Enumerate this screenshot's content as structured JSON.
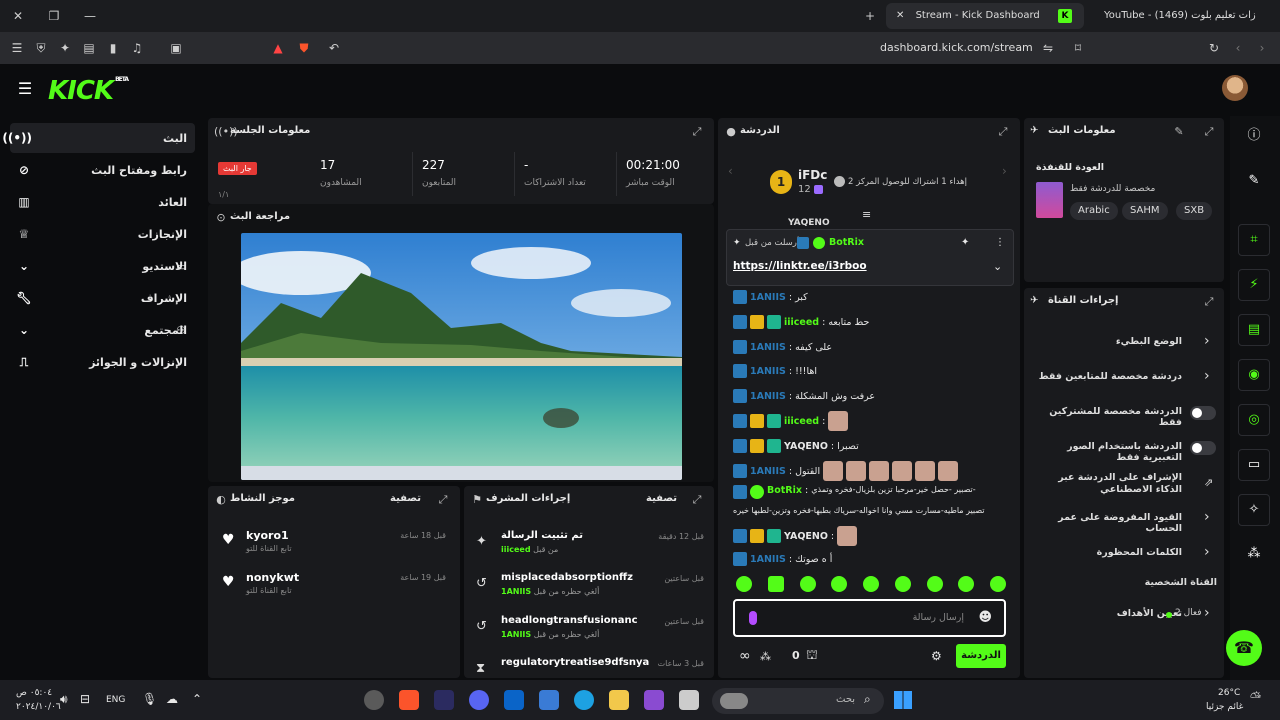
{
  "browser": {
    "tabs": [
      {
        "label": "Stream - Kick Dashboard",
        "active": true
      },
      {
        "label": "YouTube - (1469) زات تعليم بلوت",
        "active": false
      }
    ],
    "url": "dashboard.kick.com/stream"
  },
  "brand": {
    "logo": "KICK",
    "beta": "BETA",
    "accent": "#53fc18"
  },
  "nav": {
    "items": [
      {
        "label": "البث",
        "icon": "broadcast-icon",
        "active": true
      },
      {
        "label": "رابط ومفتاح البث",
        "icon": "link-icon"
      },
      {
        "label": "العائد",
        "icon": "chart-icon"
      },
      {
        "label": "الإنجازات",
        "icon": "trophy-icon"
      },
      {
        "label": "الاستديو",
        "icon": "studio-icon",
        "expandable": true
      },
      {
        "label": "الإشراف",
        "icon": "wrench-icon"
      },
      {
        "label": "المجتمع",
        "icon": "community-icon",
        "expandable": true
      },
      {
        "label": "الإنزالات و الجوائز",
        "icon": "drops-icon"
      }
    ]
  },
  "session": {
    "title": "معلومات الجلسة",
    "live_badge": "جار البث",
    "live_sub": "١/١",
    "stats": [
      {
        "value": "17",
        "label": "المشاهدون"
      },
      {
        "value": "227",
        "label": "المتابعون"
      },
      {
        "value": "-",
        "label": "تعداد الاشتراكات"
      },
      {
        "value": "00:21:00",
        "label": "الوقت مباشر"
      }
    ]
  },
  "preview": {
    "title": "مراجعة البث"
  },
  "activity": {
    "title": "موجز النشاط",
    "filter": "تصفية",
    "items": [
      {
        "name": "kyoro1",
        "sub": "تابع القناة للتو",
        "time": "قبل 18 ساعة"
      },
      {
        "name": "nonykwt",
        "sub": "تابع القناة للتو",
        "time": "قبل 19 ساعة"
      }
    ]
  },
  "mod_actions": {
    "title": "إجراءات المشرف",
    "filter": "تصفية",
    "items": [
      {
        "name": "تم تثبيت الرسالة",
        "sub_pre": "من قبل",
        "by": "iiiceed",
        "time": "قبل 12 دقيقة",
        "icon": "pin-icon"
      },
      {
        "name": "misplacedabsorptionffz",
        "sub_pre": "ألغي حظره من قبل",
        "by": "1ANIIS",
        "time": "قبل ساعتين",
        "icon": "undo-icon"
      },
      {
        "name": "headlongtransfusionanc",
        "sub_pre": "ألغي حظره من قبل",
        "by": "1ANIIS",
        "time": "قبل ساعتين",
        "icon": "undo-icon"
      },
      {
        "name": "regulatorytreatise9dfsnya",
        "sub_pre": "",
        "by": "",
        "time": "قبل 3 ساعات",
        "icon": "hourglass-icon"
      }
    ]
  },
  "chat": {
    "title": "الدردشة",
    "top_gifter": {
      "name": "iFDc",
      "rank": "1",
      "count": "12",
      "text": "إهداء 1 اشتراك للوصول المركز 2"
    },
    "pinned": {
      "label": "أرسلت من قبل",
      "user": "BotRix",
      "link": "https://linktr.ee/i3rboo"
    },
    "cut_top": "YAQENO",
    "messages": [
      {
        "user": "1ANIIS",
        "color": "#2a7ab8",
        "text": "كبر",
        "badges": [
          "mod"
        ]
      },
      {
        "user": "iiiceed",
        "color": "#53fc18",
        "text": "حط متابعه",
        "badges": [
          "mod",
          "crown",
          "sub"
        ]
      },
      {
        "user": "1ANIIS",
        "color": "#2a7ab8",
        "text": "على كيفه",
        "badges": [
          "mod"
        ]
      },
      {
        "user": "1ANIIS",
        "color": "#2a7ab8",
        "text": "!!!اها",
        "badges": [
          "mod"
        ]
      },
      {
        "user": "1ANIIS",
        "color": "#2a7ab8",
        "text": "عرفت وش المشكلة",
        "badges": [
          "mod"
        ]
      },
      {
        "user": "iiiceed",
        "color": "#53fc18",
        "text": "",
        "badges": [
          "mod",
          "crown",
          "sub"
        ],
        "emotes": 1
      },
      {
        "user": "YAQENO",
        "color": "#e8e8e8",
        "text": "تصبرا",
        "badges": [
          "mod",
          "crown",
          "sub"
        ]
      },
      {
        "user": "1ANIIS",
        "color": "#2a7ab8",
        "text": "القتول",
        "badges": [
          "mod"
        ],
        "emotes": 6
      },
      {
        "user": "BotRix",
        "color": "#53fc18",
        "text": "تصبير -حصل خير-مرحبا تزين بلزيال-فخره وتمذي-",
        "text2": "تصبير ماطيه-مسارت مسي وانا اخواله-سرياك بطبها-فخره وتزين-لطبها خيره",
        "badges": [
          "mod",
          "verified"
        ]
      },
      {
        "user": "YAQENO",
        "color": "#e8e8e8",
        "text": "",
        "badges": [
          "mod",
          "crown",
          "sub"
        ],
        "emotes": 1
      },
      {
        "user": "1ANIIS",
        "color": "#2a7ab8",
        "text": "أ ه صوتك",
        "badges": [
          "mod"
        ]
      }
    ],
    "input_placeholder": "إرسال رسالة",
    "send_label": "الدردشة",
    "infinite": "∞",
    "count": "0"
  },
  "stream_info": {
    "title": "معلومات البث",
    "stream_title": "العودة للقنفذة",
    "category": "مخصصة للدردشة فقط",
    "tags": [
      "Arabic",
      "SAHM",
      "SXB"
    ]
  },
  "channel_actions": {
    "title": "إجراءات القناة",
    "rows": [
      {
        "label": "الوضع البطيء",
        "kind": "chevron"
      },
      {
        "label": "دردشة مخصصة للمتابعين فقط",
        "kind": "chevron"
      },
      {
        "label": "الدردشة مخصصة للمشتركين فقط",
        "kind": "toggle"
      },
      {
        "label": "الدردشة باستخدام الصور التعبيرية فقط",
        "kind": "toggle"
      },
      {
        "label": "الإشراف على الدردشة عبر الذكاء الاصطناعي",
        "kind": "external"
      },
      {
        "label": "القيود المفروضة على عمر الحساب",
        "kind": "chevron"
      },
      {
        "label": "الكلمات المحظورة",
        "kind": "chevron"
      }
    ],
    "section": "القناة الشخصية",
    "goals_label": "تعيين الأهداف",
    "goals_status": "فعال 2"
  },
  "taskbar": {
    "time": "٠٥:٠٤ ص",
    "date": "٢٠٢٤/١٠/٠٦",
    "lang": "ENG",
    "search": "بحث",
    "weather_temp": "26°C",
    "weather_desc": "غائم جزئيا"
  }
}
